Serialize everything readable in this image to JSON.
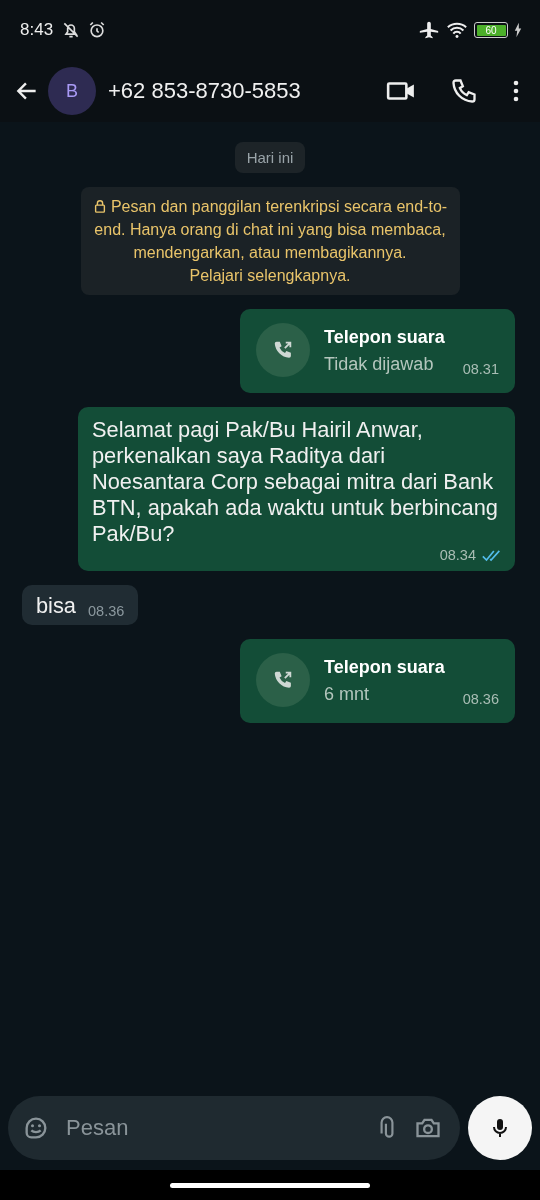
{
  "status_bar": {
    "time": "8:43",
    "battery": "60"
  },
  "header": {
    "avatar": "B",
    "title": "+62 853-8730-5853"
  },
  "date_chip": "Hari ini",
  "notice": {
    "text": "Pesan dan panggilan terenkripsi secara end-to-end. Hanya orang di chat ini yang bisa membaca, mendengarkan, atau membagikannya.",
    "link": "Pelajari selengkapnya."
  },
  "messages": [
    {
      "kind": "call",
      "outgoing": true,
      "title": "Telepon suara",
      "detail": "Tidak dijawab",
      "time": "08.31"
    },
    {
      "kind": "text",
      "outgoing": true,
      "text": "Selamat pagi Pak/Bu Hairil Anwar, perkenalkan saya Raditya dari Noesantara Corp sebagai mitra dari Bank BTN, apakah ada waktu untuk berbincang Pak/Bu?",
      "time": "08.34",
      "read": true
    },
    {
      "kind": "text",
      "outgoing": false,
      "text": "bisa",
      "time": "08.36"
    },
    {
      "kind": "call",
      "outgoing": true,
      "title": "Telepon suara",
      "detail": "6 mnt",
      "time": "08.36"
    }
  ],
  "composer": {
    "placeholder": "Pesan"
  }
}
